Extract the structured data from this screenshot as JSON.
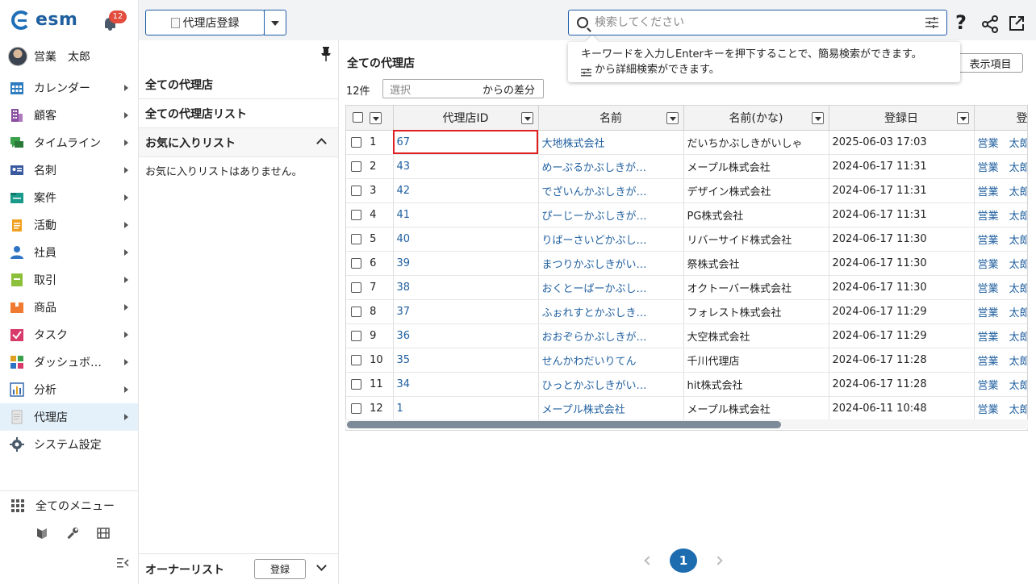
{
  "app": {
    "logo_text": "esm",
    "notifications_count": "12"
  },
  "user": {
    "name": "営業　太郎"
  },
  "sidebar": {
    "items": [
      {
        "label": "カレンダー",
        "icon": "calendar-icon",
        "color": "#2e7bbf"
      },
      {
        "label": "顧客",
        "icon": "building-icon",
        "color": "#8a4fa0"
      },
      {
        "label": "タイムライン",
        "icon": "chat-icon",
        "color": "#3aa14a"
      },
      {
        "label": "名刺",
        "icon": "card-icon",
        "color": "#3a5aa0"
      },
      {
        "label": "案件",
        "icon": "folder-icon",
        "color": "#1a9a8a"
      },
      {
        "label": "活動",
        "icon": "clipboard-icon",
        "color": "#f0a020"
      },
      {
        "label": "社員",
        "icon": "person-icon",
        "color": "#2d74c4"
      },
      {
        "label": "取引",
        "icon": "book-icon",
        "color": "#8cbf3a"
      },
      {
        "label": "商品",
        "icon": "box-icon",
        "color": "#f07a30"
      },
      {
        "label": "タスク",
        "icon": "task-icon",
        "color": "#d83a6a"
      },
      {
        "label": "ダッシュボ…",
        "icon": "dashboard-icon",
        "color": "#e0a020"
      },
      {
        "label": "分析",
        "icon": "chart-icon",
        "color": "#3a6ab0"
      },
      {
        "label": "代理店",
        "icon": "document-icon",
        "color": "#c0c0c0"
      }
    ],
    "settings_label": "システム設定",
    "all_menu_label": "全てのメニュー"
  },
  "toolbar": {
    "register_label": "代理店登録",
    "search_placeholder": "検索してください"
  },
  "tooltip": {
    "line1": "キーワードを入力しEnterキーを押下することで、簡易検索ができます。",
    "line2": "から詳細検索ができます。"
  },
  "midpanel": {
    "all_agencies": "全ての代理店",
    "all_agency_lists": "全ての代理店リスト",
    "favorites_header": "お気に入りリスト",
    "favorites_empty": "お気に入りリストはありません。",
    "owner_list": "オーナーリスト",
    "owner_register": "登録"
  },
  "main": {
    "title": "全ての代理店",
    "display_items": "表示項目",
    "count": "12件",
    "diff_placeholder": "選択",
    "diff_suffix": "からの差分",
    "columns": [
      "代理店ID",
      "名前",
      "名前(かな)",
      "登録日",
      "登"
    ],
    "rows": [
      {
        "n": "1",
        "id": "67",
        "name": "大地株式会社",
        "kana": "だいちかぶしきがいしゃ",
        "date": "2025-06-03 17:03",
        "user": "営業　太郎"
      },
      {
        "n": "2",
        "id": "43",
        "name": "めーぷるかぶしきが…",
        "kana": "メープル株式会社",
        "date": "2024-06-17 11:31",
        "user": "営業　太郎"
      },
      {
        "n": "3",
        "id": "42",
        "name": "でざいんかぶしきが…",
        "kana": "デザイン株式会社",
        "date": "2024-06-17 11:31",
        "user": "営業　太郎"
      },
      {
        "n": "4",
        "id": "41",
        "name": "ぴーじーかぶしきが…",
        "kana": "PG株式会社",
        "date": "2024-06-17 11:31",
        "user": "営業　太郎"
      },
      {
        "n": "5",
        "id": "40",
        "name": "りばーさいどかぶし…",
        "kana": "リバーサイド株式会社",
        "date": "2024-06-17 11:30",
        "user": "営業　太郎"
      },
      {
        "n": "6",
        "id": "39",
        "name": "まつりかぶしきがい…",
        "kana": "祭株式会社",
        "date": "2024-06-17 11:30",
        "user": "営業　太郎"
      },
      {
        "n": "7",
        "id": "38",
        "name": "おくとーばーかぶし…",
        "kana": "オクトーバー株式会社",
        "date": "2024-06-17 11:30",
        "user": "営業　太郎"
      },
      {
        "n": "8",
        "id": "37",
        "name": "ふぉれすとかぶしき…",
        "kana": "フォレスト株式会社",
        "date": "2024-06-17 11:29",
        "user": "営業　太郎"
      },
      {
        "n": "9",
        "id": "36",
        "name": "おおぞらかぶしきが…",
        "kana": "大空株式会社",
        "date": "2024-06-17 11:29",
        "user": "営業　太郎"
      },
      {
        "n": "10",
        "id": "35",
        "name": "せんかわだいりてん",
        "kana": "千川代理店",
        "date": "2024-06-17 11:28",
        "user": "営業　太郎"
      },
      {
        "n": "11",
        "id": "34",
        "name": "ひっとかぶしきがい…",
        "kana": "hit株式会社",
        "date": "2024-06-17 11:28",
        "user": "営業　太郎"
      },
      {
        "n": "12",
        "id": "1",
        "name": "メープル株式会社",
        "kana": "メープル株式会社",
        "date": "2024-06-11 10:48",
        "user": "営業　太郎"
      }
    ],
    "page": "1"
  },
  "colors": {
    "accent": "#1e5ea8",
    "link": "#1f5f9f",
    "badge": "#e34b3c",
    "highlight": "#e02020",
    "active_bg": "#e4f1fb"
  }
}
